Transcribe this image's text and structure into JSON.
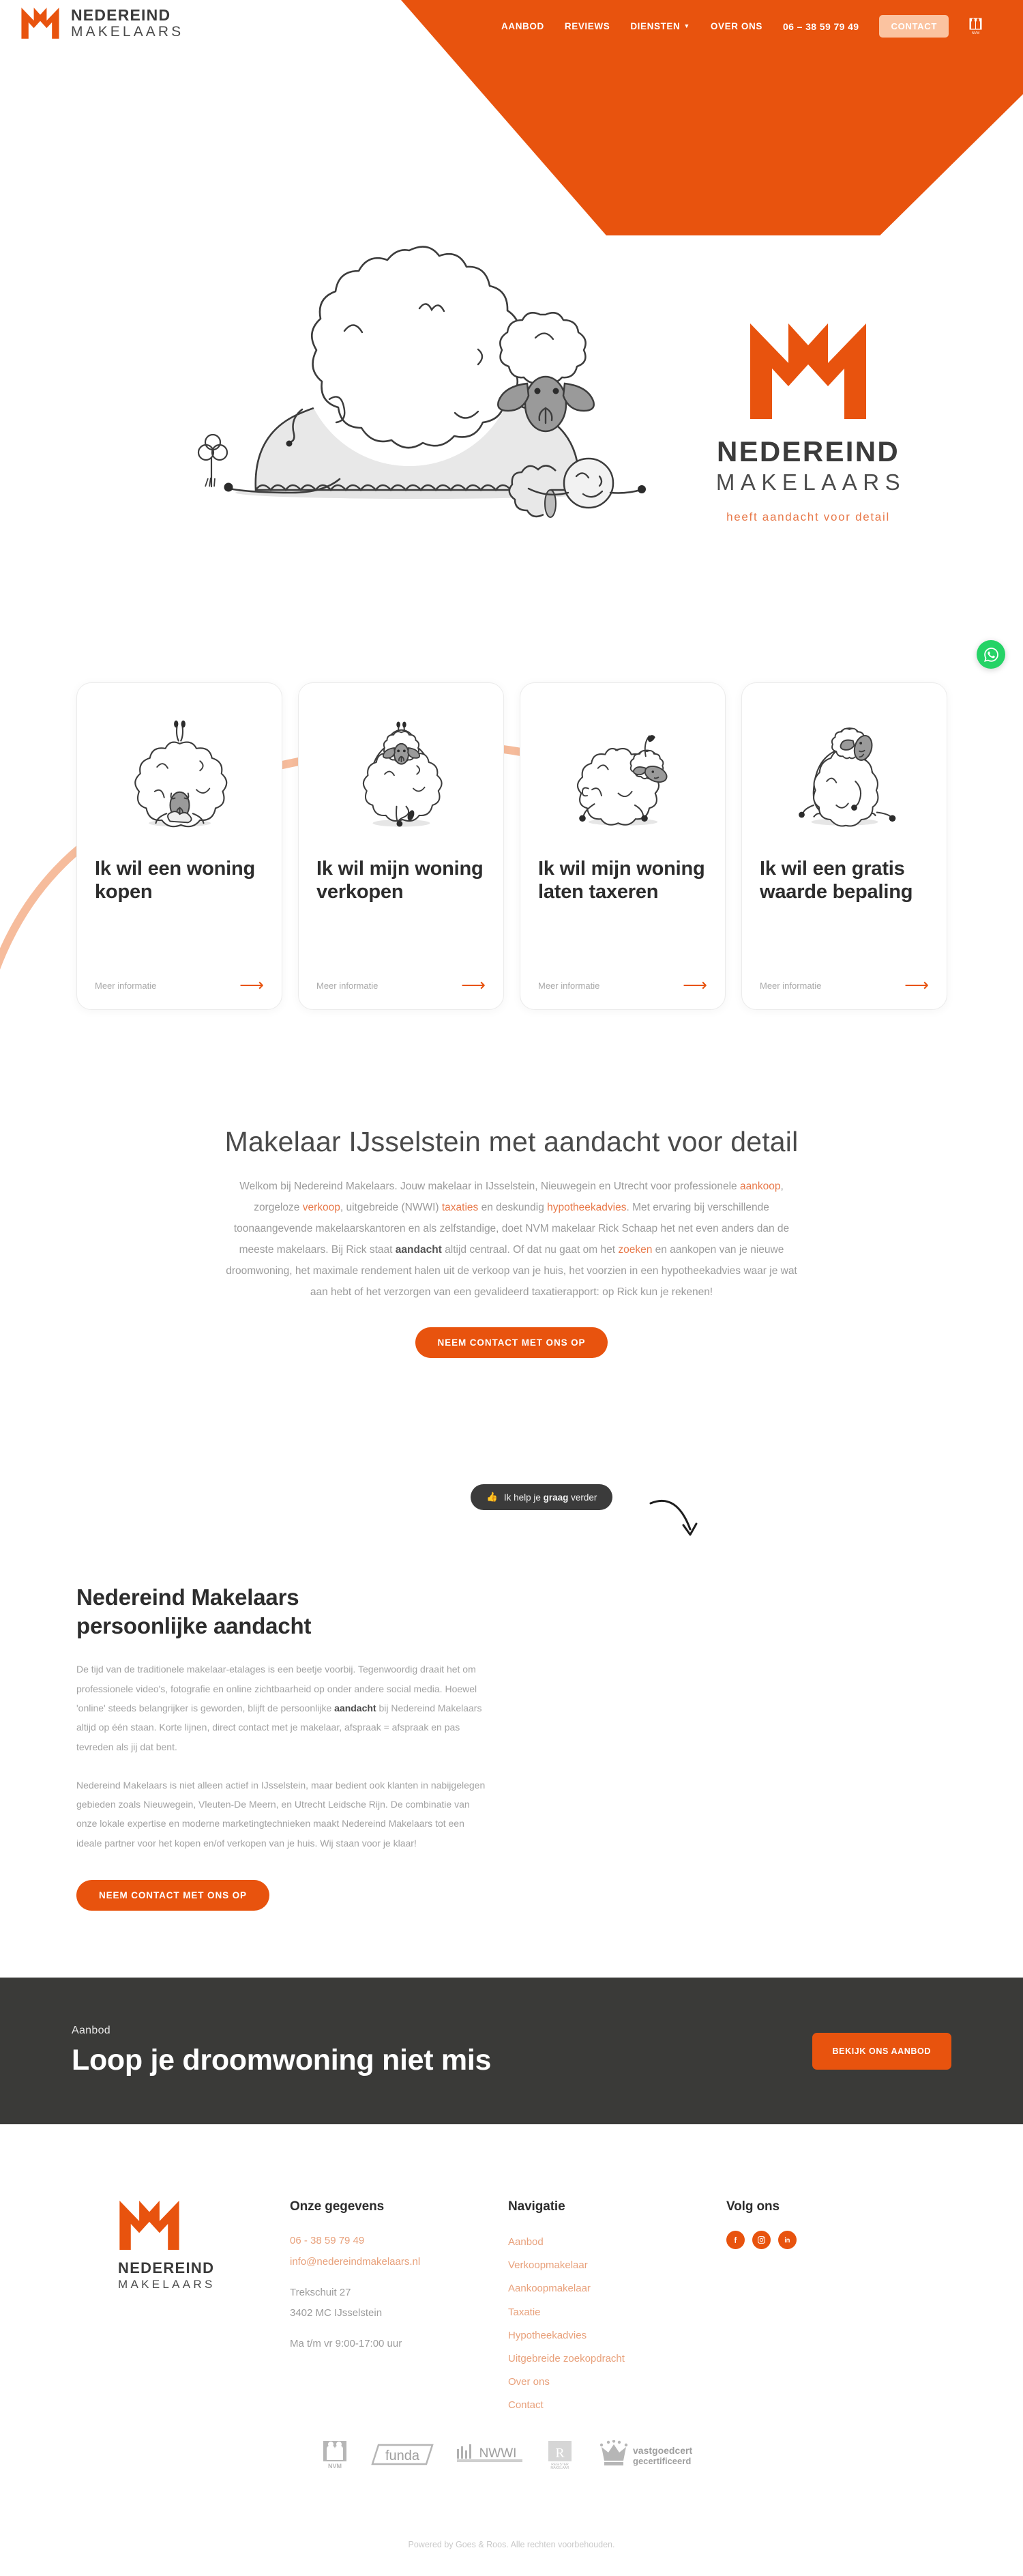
{
  "brand": {
    "name": "NEDEREIND",
    "sub": "MAKELAARS",
    "tagline": "heeft aandacht voor detail"
  },
  "nav": {
    "items": [
      {
        "label": "AANBOD",
        "caret": false
      },
      {
        "label": "REVIEWS",
        "caret": false
      },
      {
        "label": "DIENSTEN",
        "caret": true
      },
      {
        "label": "OVER ONS",
        "caret": false
      }
    ],
    "phone": "06 – 38 59 79 49",
    "contact_label": "CONTACT",
    "nvm_label": "NVM"
  },
  "cards": [
    {
      "title": "Ik wil een woning kopen",
      "more": "Meer informatie",
      "art": "sheep-handstand"
    },
    {
      "title": "Ik wil mijn woning verkopen",
      "more": "Meer informatie",
      "art": "sheep-dancing"
    },
    {
      "title": "Ik wil mijn woning laten taxeren",
      "more": "Meer informatie",
      "art": "sheep-measuring"
    },
    {
      "title": "Ik wil een gratis waarde bepaling",
      "more": "Meer informatie",
      "art": "sheep-sitting"
    }
  ],
  "intro": {
    "title": "Makelaar IJsselstein met aandacht voor detail",
    "paragraph_parts": [
      {
        "t": "Welkom bij Nedereind Makelaars. Jouw makelaar in IJsselstein, Nieuwegein en Utrecht voor professionele ",
        "s": "n"
      },
      {
        "t": "aankoop",
        "s": "link"
      },
      {
        "t": ", zorgeloze ",
        "s": "n"
      },
      {
        "t": "verkoop",
        "s": "link"
      },
      {
        "t": ", uitgebreide (NWWI) ",
        "s": "n"
      },
      {
        "t": "taxaties",
        "s": "link"
      },
      {
        "t": " en deskundig ",
        "s": "n"
      },
      {
        "t": "hypotheekadvies",
        "s": "link"
      },
      {
        "t": ". Met ervaring bij verschillende toonaangevende makelaarskantoren en als zelfstandige, doet NVM makelaar Rick Schaap het net even anders dan de meeste makelaars. Bij Rick staat ",
        "s": "n"
      },
      {
        "t": "aandacht",
        "s": "bold"
      },
      {
        "t": " altijd centraal. Of dat nu gaat om het ",
        "s": "n"
      },
      {
        "t": "zoeken",
        "s": "link"
      },
      {
        "t": " en aankopen van je nieuwe droomwoning, het maximale rendement halen uit de verkoop van je huis, het voorzien in een hypotheekadvies waar je wat aan hebt of het verzorgen van een gevalideerd taxatierapport: op Rick kun je rekenen!",
        "s": "n"
      }
    ],
    "cta": "NEEM CONTACT MET ONS OP"
  },
  "chat": {
    "emoji": "👍",
    "before": "Ik help je ",
    "strong": "graag",
    "after": " verder"
  },
  "about": {
    "title_line1": "Nedereind Makelaars",
    "title_line2": "persoonlijke aandacht",
    "p1_parts": [
      {
        "t": "De tijd van de traditionele makelaar-etalages is een beetje voorbij. Tegenwoordig draait het om professionele video's, fotografie en online zichtbaarheid op onder andere social media. Hoewel 'online' steeds belangrijker is geworden, blijft de persoonlijke ",
        "s": "n"
      },
      {
        "t": "aandacht",
        "s": "bold"
      },
      {
        "t": " bij Nedereind Makelaars altijd op één staan. Korte lijnen, direct contact met je makelaar, afspraak = afspraak en pas tevreden als jij dat bent.",
        "s": "n"
      }
    ],
    "p2": "Nedereind Makelaars is niet alleen actief in IJsselstein, maar bedient ook klanten in nabijgelegen gebieden zoals Nieuwegein, Vleuten-De Meern, en Utrecht Leidsche Rijn. De combinatie van onze lokale expertise en moderne marketingtechnieken maakt Nedereind Makelaars tot een ideale partner voor het kopen en/of verkopen van je huis. Wij staan voor je klaar!",
    "cta": "NEEM CONTACT MET ONS OP"
  },
  "banner": {
    "eyebrow": "Aanbod",
    "title": "Loop je droomwoning niet mis",
    "cta": "BEKIJK ONS AANBOD"
  },
  "footer": {
    "gegevens": {
      "heading": "Onze gegevens",
      "phone": "06 - 38 59 79 49",
      "email": "info@nedereindmakelaars.nl",
      "street": "Trekschuit 27",
      "city": "3402 MC IJsselstein",
      "hours": "Ma t/m vr 9:00-17:00 uur"
    },
    "navigatie": {
      "heading": "Navigatie",
      "links": [
        "Aanbod",
        "Verkoopmakelaar",
        "Aankoopmakelaar",
        "Taxatie",
        "Hypotheekadvies",
        "Uitgebreide zoekopdracht",
        "Over ons",
        "Contact"
      ]
    },
    "volg": {
      "heading": "Volg ons",
      "socials": [
        "facebook-icon",
        "instagram-icon",
        "linkedin-icon"
      ]
    },
    "partners": [
      "NVM",
      "funda",
      "NWWI",
      "Register Makelaar Taxateur",
      "vastgoedcert gecertificeerd"
    ],
    "copyright": "Powered by Goes & Roos. Alle rechten voorbehouden."
  },
  "colors": {
    "orange": "#E8530E",
    "orange_light": "#E8A07A",
    "dark": "#3a3a38",
    "whatsapp": "#25D366"
  }
}
